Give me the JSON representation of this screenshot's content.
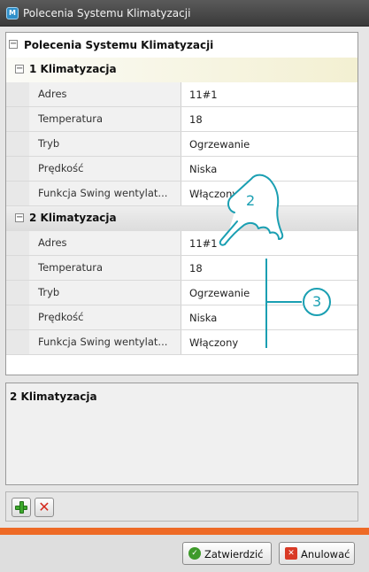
{
  "window": {
    "title": "Polecenia Systemu Klimatyzacji"
  },
  "grid": {
    "root_label": "Polecenia Systemu Klimatyzacji",
    "groups": [
      {
        "label": "1 Klimatyzacja",
        "expanded_glyph": "−",
        "rows": [
          {
            "name": "Adres",
            "value": "11#1"
          },
          {
            "name": "Temperatura",
            "value": "18"
          },
          {
            "name": "Tryb",
            "value": "Ogrzewanie"
          },
          {
            "name": "Prędkość",
            "value": "Niska"
          },
          {
            "name": "Funkcja Swing wentylat...",
            "value": "Włączony"
          }
        ]
      },
      {
        "label": "2 Klimatyzacja",
        "expanded_glyph": "−",
        "rows": [
          {
            "name": "Adres",
            "value": "11#1"
          },
          {
            "name": "Temperatura",
            "value": "18"
          },
          {
            "name": "Tryb",
            "value": "Ogrzewanie"
          },
          {
            "name": "Prędkość",
            "value": "Niska"
          },
          {
            "name": "Funkcja Swing wentylat...",
            "value": "Włączony"
          }
        ]
      }
    ]
  },
  "description": {
    "title": "2 Klimatyzacja"
  },
  "toolbar": {
    "add_icon": "green-plus-icon",
    "delete_icon": "red-x-icon"
  },
  "footer": {
    "ok_label": "Zatwierdzić",
    "cancel_label": "Anulować"
  },
  "annotations": {
    "callout_2": "2",
    "callout_3": "3",
    "color": "#1a9fb2"
  },
  "colors": {
    "accent_bar": "#ee6a26",
    "titlebar": "#4a4a4a"
  }
}
